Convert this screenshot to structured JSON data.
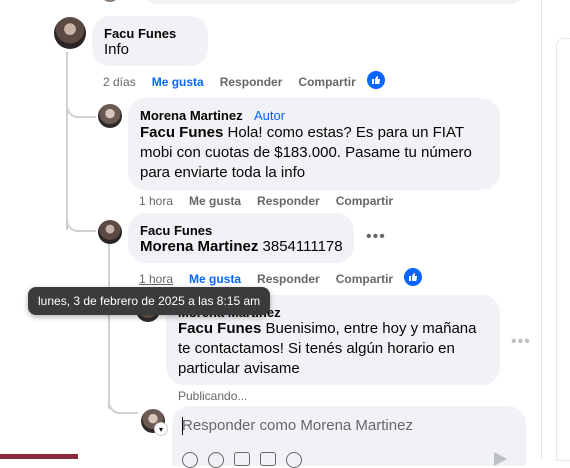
{
  "comments": [
    {
      "author": "Facu Funes",
      "text": "Info",
      "time": "2 días",
      "like": "Me gusta",
      "reply": "Responder",
      "share": "Compartir"
    },
    {
      "author": "Morena Martinez",
      "badge": "Autor",
      "mention": "Facu Funes",
      "text": " Hola! como estas? Es para un FIAT mobi con cuotas de $183.000. Pasame tu número para enviarte toda la info",
      "time": "1 hora",
      "like": "Me gusta",
      "reply": "Responder",
      "share": "Compartir"
    },
    {
      "author": "Facu Funes",
      "mention": "Morena Martinez",
      "text": " 3854111178",
      "time": "1 hora",
      "like": "Me gusta",
      "reply": "Responder",
      "share": "Compartir"
    },
    {
      "author": "Morena Martinez",
      "mention": "Facu Funes",
      "text": " Buenisimo, entre hoy y mañana te contactamos! Si tenés algún horario en particular avisame",
      "status": "Publicando..."
    }
  ],
  "tooltip": "lunes, 3 de febrero de 2025 a las 8:15 am",
  "reply_box": {
    "placeholder": "Responder como Morena Martinez"
  },
  "colors": {
    "accent": "#0866ff",
    "bubble": "#f0f2f5",
    "muted": "#65676b"
  },
  "icons": [
    "like-reaction-icon",
    "more-options-icon",
    "emoji-icon",
    "camera-icon",
    "gif-icon",
    "sticker-icon",
    "send-icon"
  ]
}
